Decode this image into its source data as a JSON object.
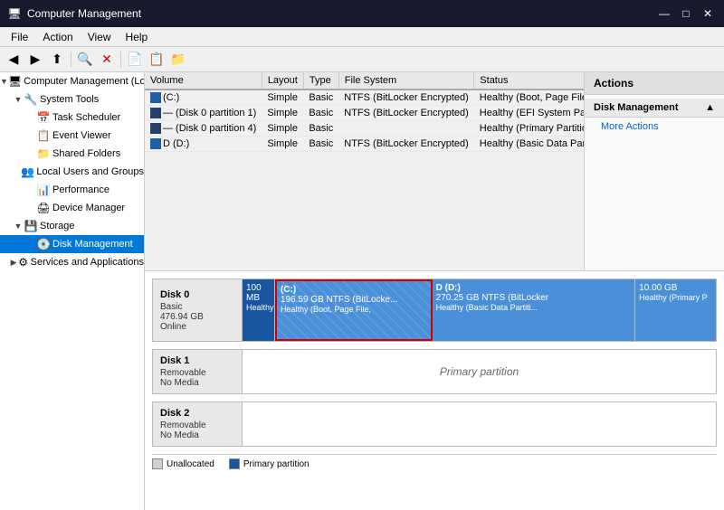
{
  "titleBar": {
    "icon": "🖥",
    "title": "Computer Management",
    "minimizeBtn": "—",
    "maximizeBtn": "□",
    "closeBtn": "✕"
  },
  "menuBar": {
    "items": [
      "File",
      "Action",
      "View",
      "Help"
    ]
  },
  "toolbar": {
    "buttons": [
      "◀",
      "▶",
      "⬆",
      "🔍",
      "X",
      "📄",
      "📋",
      "📁"
    ]
  },
  "treePanel": {
    "header": "Computer Management (Local",
    "items": [
      {
        "label": "Computer Management (Local",
        "level": 0,
        "arrow": "▼",
        "icon": "🖥",
        "selected": false
      },
      {
        "label": "System Tools",
        "level": 1,
        "arrow": "▼",
        "icon": "🔧",
        "selected": false
      },
      {
        "label": "Task Scheduler",
        "level": 2,
        "arrow": "",
        "icon": "📅",
        "selected": false
      },
      {
        "label": "Event Viewer",
        "level": 2,
        "arrow": "",
        "icon": "📋",
        "selected": false
      },
      {
        "label": "Shared Folders",
        "level": 2,
        "arrow": "",
        "icon": "📁",
        "selected": false
      },
      {
        "label": "Local Users and Groups",
        "level": 2,
        "arrow": "",
        "icon": "👥",
        "selected": false
      },
      {
        "label": "Performance",
        "level": 2,
        "arrow": "",
        "icon": "📊",
        "selected": false
      },
      {
        "label": "Device Manager",
        "level": 2,
        "arrow": "",
        "icon": "🖨",
        "selected": false
      },
      {
        "label": "Storage",
        "level": 1,
        "arrow": "▼",
        "icon": "💾",
        "selected": false
      },
      {
        "label": "Disk Management",
        "level": 2,
        "arrow": "",
        "icon": "💽",
        "selected": true
      },
      {
        "label": "Services and Applications",
        "level": 1,
        "arrow": "▶",
        "icon": "⚙",
        "selected": false
      }
    ]
  },
  "volumeTable": {
    "columns": [
      "Volume",
      "Layout",
      "Type",
      "File System",
      "Status"
    ],
    "rows": [
      {
        "volumeIcon": "blue",
        "volume": "(C:)",
        "layout": "Simple",
        "type": "Basic",
        "fileSystem": "NTFS (BitLocker Encrypted)",
        "status": "Healthy (Boot, Page File, Crash Dump, Basi..."
      },
      {
        "volumeIcon": "dark-blue",
        "volume": "— (Disk 0 partition 1)",
        "layout": "Simple",
        "type": "Basic",
        "fileSystem": "NTFS (BitLocker Encrypted)",
        "status": "Healthy (EFI System Partition)"
      },
      {
        "volumeIcon": "dark-blue",
        "volume": "— (Disk 0 partition 4)",
        "layout": "Simple",
        "type": "Basic",
        "fileSystem": "",
        "status": "Healthy (Primary Partition)"
      },
      {
        "volumeIcon": "blue",
        "volume": "D (D:)",
        "layout": "Simple",
        "type": "Basic",
        "fileSystem": "NTFS (BitLocker Encrypted)",
        "status": "Healthy (Basic Data Partition)"
      }
    ]
  },
  "actionsPanel": {
    "header": "Actions",
    "sections": [
      {
        "title": "Disk Management",
        "arrow": "▲",
        "links": [
          "More Actions"
        ]
      }
    ]
  },
  "diskViz": {
    "disks": [
      {
        "id": "disk0",
        "name": "Disk 0",
        "type": "Basic",
        "size": "476.94 GB",
        "status": "Online",
        "partitions": [
          {
            "label": "",
            "size": "100 MB",
            "fs": "",
            "status": "Healthy",
            "style": "system",
            "flex": 1
          },
          {
            "label": "(C:)",
            "size": "196.59 GB NTFS (BitLocke...",
            "fs": "",
            "status": "Healthy (Boot, Page File,",
            "style": "primary-main",
            "flex": 6
          },
          {
            "label": "D (D:)",
            "size": "270.25 GB NTFS (BitLocker",
            "fs": "",
            "status": "Healthy (Basic Data Partiti...",
            "style": "primary",
            "flex": 8
          },
          {
            "label": "",
            "size": "10.00 GB",
            "fs": "",
            "status": "Healthy (Primary P",
            "style": "primary",
            "flex": 3
          }
        ]
      },
      {
        "id": "disk1",
        "name": "Disk 1",
        "type": "Removable",
        "size": "",
        "status": "No Media",
        "noMedia": true,
        "noMediaLabel": "Primary partition"
      },
      {
        "id": "disk2",
        "name": "Disk 2",
        "type": "Removable",
        "size": "",
        "status": "No Media",
        "noMedia": true,
        "noMediaLabel": ""
      }
    ],
    "legend": [
      {
        "label": "Unallocated",
        "style": "unalloc"
      },
      {
        "label": "Primary partition",
        "style": "primary"
      }
    ]
  }
}
